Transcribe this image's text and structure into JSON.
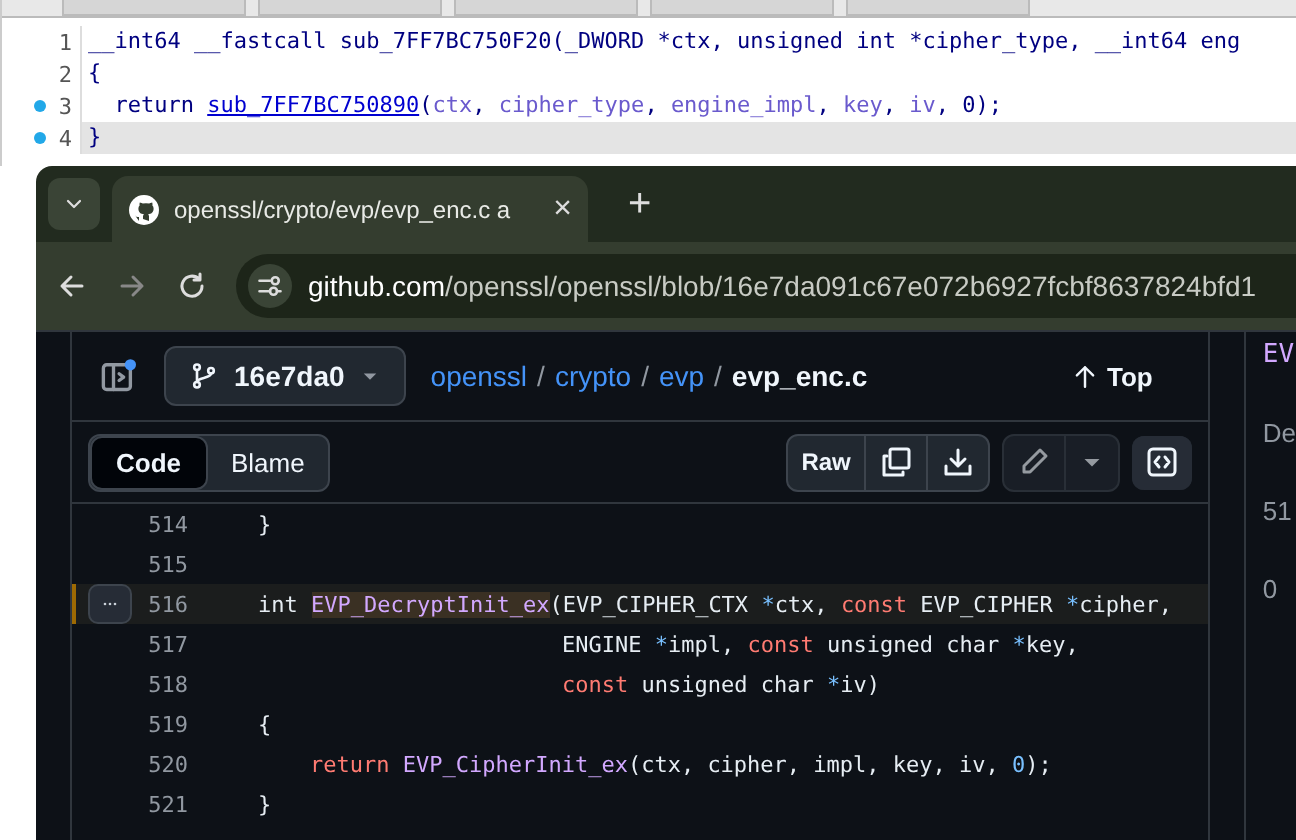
{
  "decompiler": {
    "lines": [
      {
        "number": "1",
        "marked": false,
        "current": false,
        "tokens": [
          {
            "kind": "plain",
            "text": "__int64 __fastcall sub_7FF7BC750F20(_DWORD *ctx, unsigned int *cipher_type, __int64 eng"
          }
        ]
      },
      {
        "number": "2",
        "marked": false,
        "current": false,
        "tokens": [
          {
            "kind": "plain",
            "text": "{"
          }
        ]
      },
      {
        "number": "3",
        "marked": true,
        "current": false,
        "tokens": [
          {
            "kind": "plain",
            "text": "  return "
          },
          {
            "kind": "func",
            "text": "sub_7FF7BC750890"
          },
          {
            "kind": "plain",
            "text": "("
          },
          {
            "kind": "var",
            "text": "ctx"
          },
          {
            "kind": "plain",
            "text": ", "
          },
          {
            "kind": "var",
            "text": "cipher_type"
          },
          {
            "kind": "plain",
            "text": ", "
          },
          {
            "kind": "var",
            "text": "engine_impl"
          },
          {
            "kind": "plain",
            "text": ", "
          },
          {
            "kind": "var",
            "text": "key"
          },
          {
            "kind": "plain",
            "text": ", "
          },
          {
            "kind": "var",
            "text": "iv"
          },
          {
            "kind": "plain",
            "text": ", 0);"
          }
        ]
      },
      {
        "number": "4",
        "marked": true,
        "current": true,
        "tokens": [
          {
            "kind": "plain",
            "text": "}"
          }
        ]
      }
    ]
  },
  "browser": {
    "tab": {
      "title": "openssl/crypto/evp/evp_enc.c a",
      "close": "×"
    },
    "new_tab": "+",
    "url": {
      "host": "github.com",
      "path": "/openssl/openssl/blob/16e7da091c67e072b6927fcbf8637824bfd1"
    }
  },
  "file_header": {
    "branch": "16e7da0",
    "breadcrumbs": [
      {
        "text": "openssl",
        "current": false
      },
      {
        "separator": "/",
        "text": "crypto",
        "current": false
      },
      {
        "separator": "/",
        "text": "evp",
        "current": false
      },
      {
        "separator": "/",
        "text": "evp_enc.c",
        "current": true
      }
    ],
    "top_button": "Top"
  },
  "view_tabs": [
    {
      "label": "Code",
      "selected": true
    },
    {
      "label": "Blame",
      "selected": false
    }
  ],
  "raw_button": "Raw",
  "code": {
    "lines": [
      {
        "number": "514",
        "highlighted": false,
        "tokens": [
          {
            "kind": "plain",
            "text": "}"
          }
        ]
      },
      {
        "number": "515",
        "highlighted": false
      },
      {
        "number": "516",
        "highlighted": true,
        "tokens": [
          {
            "kind": "plain",
            "text": "int "
          },
          {
            "kind": "func",
            "text": "EVP_DecryptInit_ex"
          },
          {
            "kind": "plain",
            "text": "(EVP_CIPHER_CTX "
          },
          {
            "kind": "op",
            "text": "*"
          },
          {
            "kind": "plain",
            "text": "ctx, "
          },
          {
            "kind": "keyword",
            "text": "const"
          },
          {
            "kind": "plain",
            "text": " EVP_CIPHER "
          },
          {
            "kind": "op",
            "text": "*"
          },
          {
            "kind": "plain",
            "text": "cipher,"
          }
        ]
      },
      {
        "number": "517",
        "highlighted": false,
        "continuation": true,
        "tokens": [
          {
            "kind": "plain",
            "text": "ENGINE "
          },
          {
            "kind": "op",
            "text": "*"
          },
          {
            "kind": "plain",
            "text": "impl, "
          },
          {
            "kind": "keyword",
            "text": "const"
          },
          {
            "kind": "plain",
            "text": " unsigned char "
          },
          {
            "kind": "op",
            "text": "*"
          },
          {
            "kind": "plain",
            "text": "key,"
          }
        ]
      },
      {
        "number": "518",
        "highlighted": false,
        "continuation": true,
        "tokens": [
          {
            "kind": "keyword",
            "text": "const"
          },
          {
            "kind": "plain",
            "text": " unsigned char "
          },
          {
            "kind": "op",
            "text": "*"
          },
          {
            "kind": "plain",
            "text": "iv)"
          }
        ]
      },
      {
        "number": "519",
        "highlighted": false,
        "tokens": [
          {
            "kind": "plain",
            "text": "{"
          }
        ]
      },
      {
        "number": "520",
        "highlighted": false,
        "nested": true,
        "tokens": [
          {
            "kind": "keyword",
            "text": "return "
          },
          {
            "kind": "func",
            "text": "EVP_CipherInit_ex"
          },
          {
            "kind": "plain",
            "text": "(ctx, cipher, impl, key, iv, "
          },
          {
            "kind": "number",
            "text": "0"
          },
          {
            "kind": "plain",
            "text": ");"
          }
        ]
      },
      {
        "number": "521",
        "highlighted": false,
        "tokens": [
          {
            "kind": "plain",
            "text": "}"
          }
        ]
      }
    ]
  },
  "side_panel": {
    "items": [
      "EV",
      "De",
      "51",
      "0"
    ]
  }
}
